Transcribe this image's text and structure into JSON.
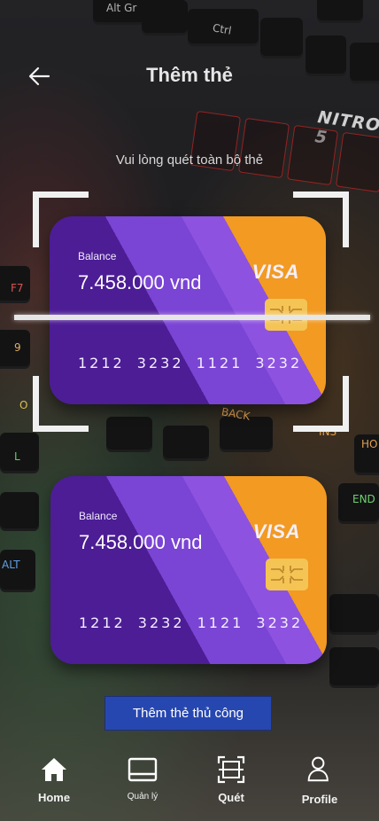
{
  "header": {
    "title": "Thêm thẻ",
    "subtitle": "Vui lòng quét toàn bộ thẻ"
  },
  "background_decor": {
    "brand_text": "NITRO 5",
    "key_labels": [
      "Alt Gr",
      "Ctrl",
      "F7",
      "9",
      "O",
      "L",
      "BACK",
      "INS",
      "HO",
      "END",
      "ALT"
    ]
  },
  "cards": [
    {
      "balance_label": "Balance",
      "balance_value": "7.458.000 vnd",
      "brand": "VISA",
      "number": "1212 3232 1121 3232"
    },
    {
      "balance_label": "Balance",
      "balance_value": "7.458.000 vnd",
      "brand": "VISA",
      "number": "1212 3232 1121 3232"
    }
  ],
  "manual_button": {
    "label": "Thêm thẻ thủ công",
    "color": "#2747b0"
  },
  "nav": {
    "items": [
      {
        "label": "Home",
        "icon": "home-icon"
      },
      {
        "label": "Quản lý",
        "icon": "card-manage-icon"
      },
      {
        "label": "Quét",
        "icon": "scan-icon"
      },
      {
        "label": "Profile",
        "icon": "user-icon"
      }
    ]
  },
  "colors": {
    "card_dark_purple": "#4c1d95",
    "card_mid_purple": "#7a44d4",
    "card_orange": "#f29a22",
    "chip": "#f4c455"
  }
}
